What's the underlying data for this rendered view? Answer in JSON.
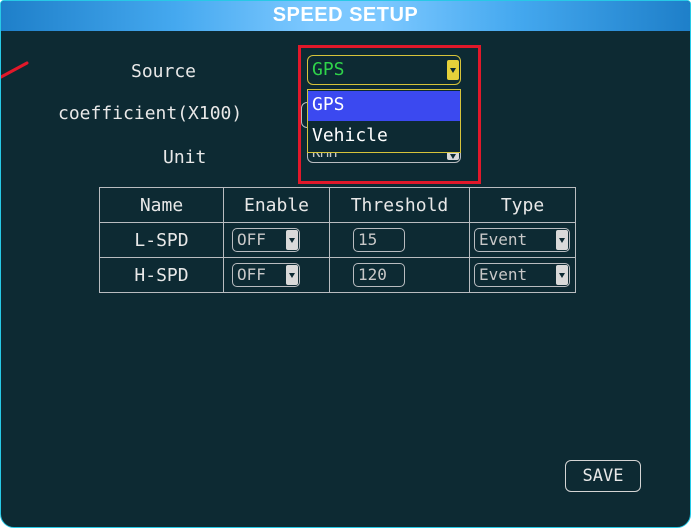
{
  "title": "SPEED SETUP",
  "fields": {
    "source_label": "Source",
    "coefficient_label": "coefficient(X100)",
    "unit_label": "Unit",
    "source_value": "GPS",
    "unit_value": "KMH"
  },
  "dropdown": {
    "options": [
      "GPS",
      "Vehicle"
    ],
    "selected": "GPS"
  },
  "table": {
    "headers": [
      "Name",
      "Enable",
      "Threshold",
      "Type"
    ],
    "rows": [
      {
        "name": "L-SPD",
        "enable": "OFF",
        "threshold": "15",
        "type": "Event"
      },
      {
        "name": "H-SPD",
        "enable": "OFF",
        "threshold": "120",
        "type": "Event"
      }
    ]
  },
  "save_label": "SAVE",
  "colors": {
    "background": "#0d2a33",
    "title_bar": "#44a8ef",
    "highlight": "#e1182a",
    "selected_option": "#3b49f0",
    "source_text": "#2fd34a"
  }
}
